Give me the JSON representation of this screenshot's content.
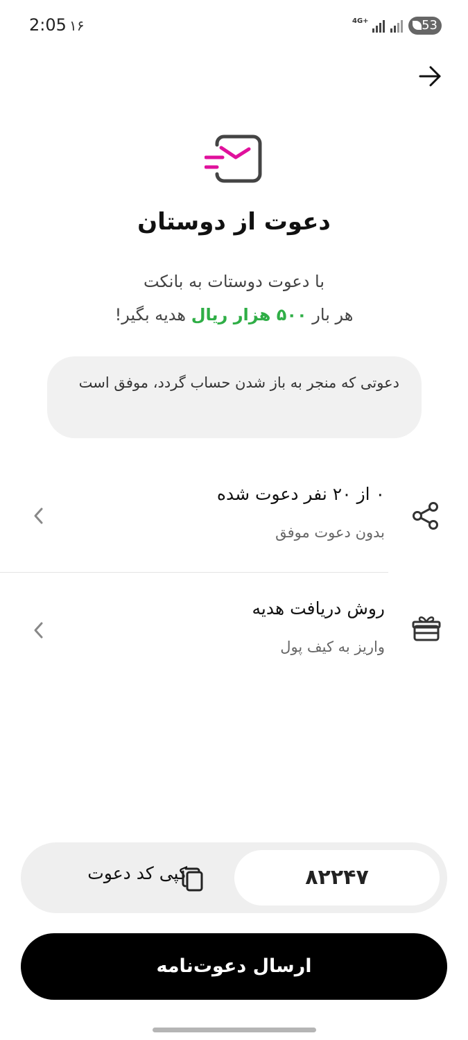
{
  "status_bar": {
    "time": "2:05",
    "date": "۱۶",
    "network": "4G+",
    "battery": "53"
  },
  "header": {
    "title": "دعوت از دوستان",
    "subtitle_line1": "با دعوت دوستات به بانکت",
    "subtitle_line2_prefix": "هر بار",
    "subtitle_amount": "۵۰۰ هزار ریال",
    "subtitle_line2_suffix": "هدیه بگیر!"
  },
  "info": {
    "text": "دعوتی که منجر به باز شدن حساب گردد، موفق است"
  },
  "rows": {
    "invited": {
      "title": "۰ از ۲۰ نفر دعوت شده",
      "subtitle": "بدون دعوت موفق",
      "icon": "share-icon"
    },
    "reward": {
      "title": "روش دریافت هدیه",
      "subtitle": "واریز به کیف پول",
      "icon": "gift-icon"
    }
  },
  "invite_code": {
    "code": "۸۲۲۴۷",
    "copy_label": "کپی کد دعوت"
  },
  "send_button": {
    "label": "ارسال دعوت‌نامه"
  },
  "colors": {
    "accent": "#e0119c",
    "highlight_green": "#2fae46",
    "primary_button": "#000000"
  }
}
